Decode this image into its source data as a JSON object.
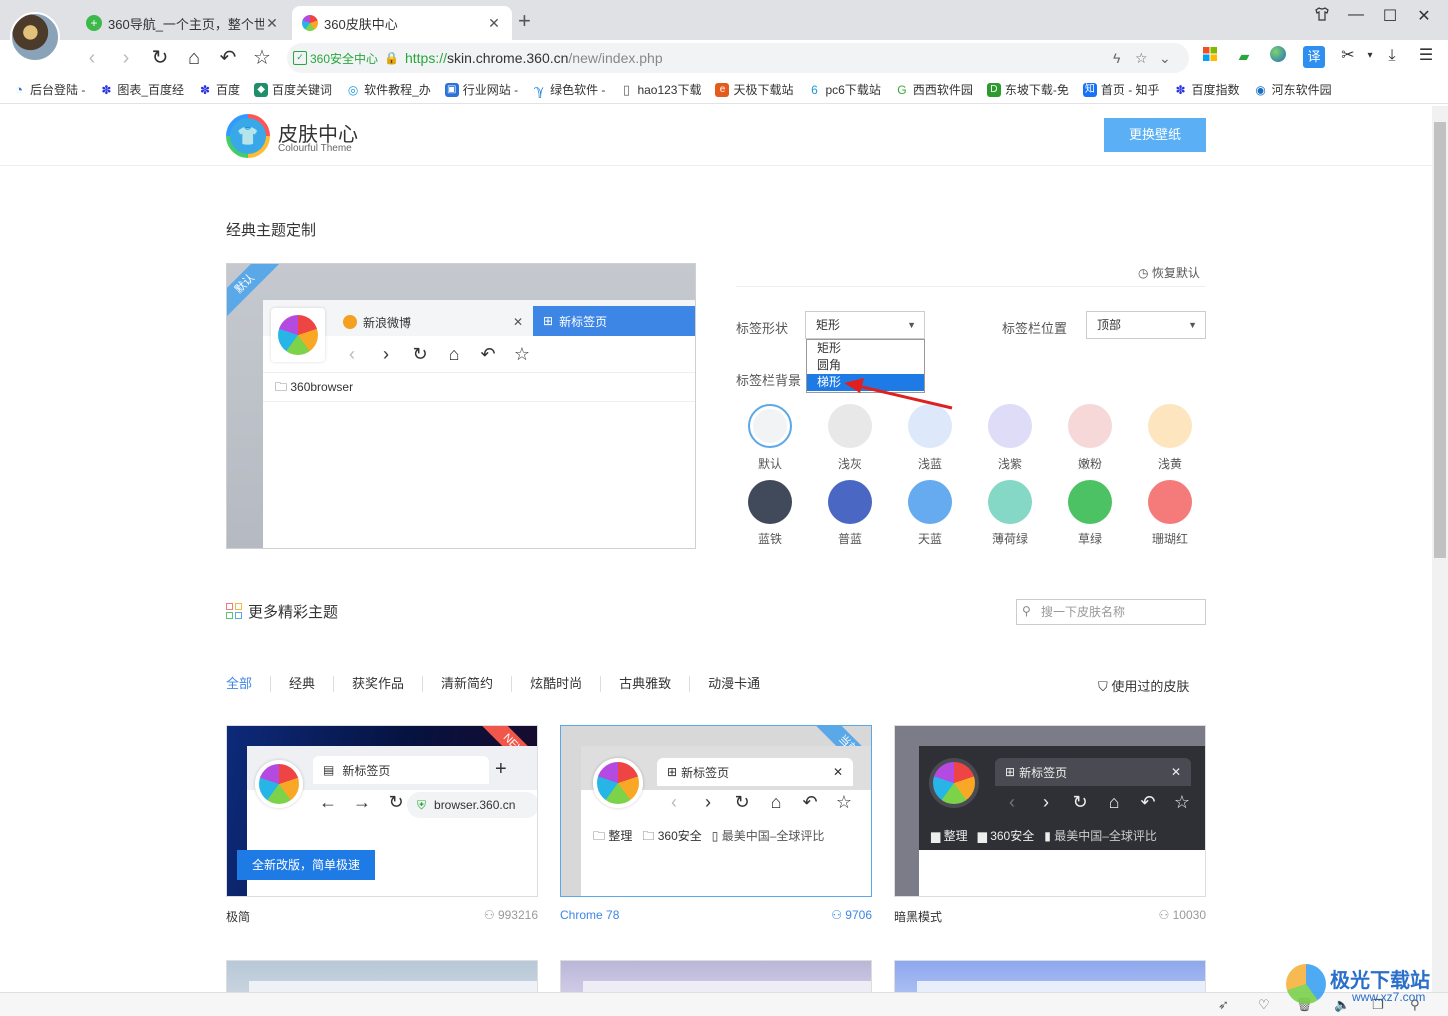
{
  "browser": {
    "tabs": [
      {
        "label": "360导航_一个主页，整个世界",
        "active": false
      },
      {
        "label": "360皮肤中心",
        "active": true
      }
    ],
    "security_label": "360安全中心",
    "url_scheme": "https://",
    "url_host": "skin.chrome.360.cn",
    "url_path": "/new/index.php",
    "translate_label": "译",
    "bookmarks": [
      "后台登陆 -",
      "图表_百度经",
      "百度",
      "百度关键词",
      "软件教程_办",
      "行业网站 -",
      "绿色软件 -",
      "hao123下载",
      "天极下载站",
      "pc6下载站",
      "西西软件园",
      "东坡下载-免",
      "首页 - 知乎",
      "百度指数",
      "河东软件园"
    ]
  },
  "header": {
    "title": "皮肤中心",
    "subtitle": "Colourful Theme",
    "change_wallpaper": "更换壁纸"
  },
  "classic": {
    "title": "经典主题定制",
    "preview": {
      "ribbon": "默认",
      "tab1": "新浪微博",
      "tab2": "新标签页",
      "bookmark": "360browser"
    },
    "restore": "恢复默认",
    "tab_shape_label": "标签形状",
    "tab_shape_value": "矩形",
    "tab_shape_options": [
      "矩形",
      "圆角",
      "梯形"
    ],
    "tab_shape_highlighted": "梯形",
    "tab_position_label": "标签栏位置",
    "tab_position_value": "顶部",
    "tab_bg_label": "标签栏背景",
    "swatches": [
      {
        "label": "默认",
        "color": "#f2f3f5"
      },
      {
        "label": "浅灰",
        "color": "#e8e8e8"
      },
      {
        "label": "浅蓝",
        "color": "#dde9fb"
      },
      {
        "label": "浅紫",
        "color": "#dedcf7"
      },
      {
        "label": "嫩粉",
        "color": "#f7d8d8"
      },
      {
        "label": "浅黄",
        "color": "#fde6bf"
      },
      {
        "label": "蓝铁",
        "color": "#414a5a"
      },
      {
        "label": "普蓝",
        "color": "#4a67c4"
      },
      {
        "label": "天蓝",
        "color": "#66aaf0"
      },
      {
        "label": "薄荷绿",
        "color": "#86d8c6"
      },
      {
        "label": "草绿",
        "color": "#4cc265"
      },
      {
        "label": "珊瑚红",
        "color": "#f57b7b"
      }
    ]
  },
  "more": {
    "title": "更多精彩主题",
    "search_placeholder": "搜一下皮肤名称",
    "categories": [
      "全部",
      "经典",
      "获奖作品",
      "清新简约",
      "炫酷时尚",
      "古典雅致",
      "动漫卡通"
    ],
    "used_label": "使用过的皮肤",
    "cards": [
      {
        "name": "极简",
        "count": "993216",
        "badge": "NEW",
        "tab": "新标签页",
        "url": "browser.360.cn",
        "banner": "全新改版，简单极速"
      },
      {
        "name": "Chrome 78",
        "count": "9706",
        "badge": "当前",
        "tab": "新标签页",
        "bm1": "整理",
        "bm2": "360安全",
        "bm3": "最美中国–全球评比"
      },
      {
        "name": "暗黑模式",
        "count": "10030",
        "tab": "新标签页",
        "bm1": "整理",
        "bm2": "360安全",
        "bm3": "最美中国–全球评比"
      }
    ]
  },
  "watermark": {
    "text": "极光下载站",
    "url": "www.xz7.com"
  }
}
